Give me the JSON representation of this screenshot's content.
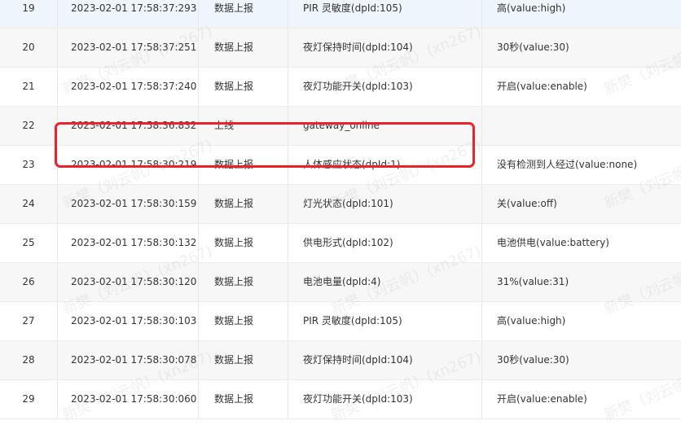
{
  "rows": [
    {
      "idx": "19",
      "time": "2023-02-01 17:58:37:293",
      "type": "数据上报",
      "event": "PIR 灵敏度(dpId:105)",
      "value": "高(value:high)"
    },
    {
      "idx": "20",
      "time": "2023-02-01 17:58:37:251",
      "type": "数据上报",
      "event": "夜灯保持时间(dpId:104)",
      "value": "30秒(value:30)"
    },
    {
      "idx": "21",
      "time": "2023-02-01 17:58:37:240",
      "type": "数据上报",
      "event": "夜灯功能开关(dpId:103)",
      "value": "开启(value:enable)"
    },
    {
      "idx": "22",
      "time": "2023-02-01 17:58:36:832",
      "type": "上线",
      "event": "gateway_online",
      "value": ""
    },
    {
      "idx": "23",
      "time": "2023-02-01 17:58:30:219",
      "type": "数据上报",
      "event": "人体感应状态(dpId:1)",
      "value": "没有检测到人经过(value:none)"
    },
    {
      "idx": "24",
      "time": "2023-02-01 17:58:30:159",
      "type": "数据上报",
      "event": "灯光状态(dpId:101)",
      "value": "关(value:off)"
    },
    {
      "idx": "25",
      "time": "2023-02-01 17:58:30:132",
      "type": "数据上报",
      "event": "供电形式(dpId:102)",
      "value": "电池供电(value:battery)"
    },
    {
      "idx": "26",
      "time": "2023-02-01 17:58:30:120",
      "type": "数据上报",
      "event": "电池电量(dpId:4)",
      "value": "31%(value:31)"
    },
    {
      "idx": "27",
      "time": "2023-02-01 17:58:30:103",
      "type": "数据上报",
      "event": "PIR 灵敏度(dpId:105)",
      "value": "高(value:high)"
    },
    {
      "idx": "28",
      "time": "2023-02-01 17:58:30:078",
      "type": "数据上报",
      "event": "夜灯保持时间(dpId:104)",
      "value": "30秒(value:30)"
    },
    {
      "idx": "29",
      "time": "2023-02-01 17:58:30:060",
      "type": "数据上报",
      "event": "夜灯功能开关(dpId:103)",
      "value": "开启(value:enable)"
    }
  ],
  "watermark": "新樊（刘云帆）(xn267)",
  "colors": {
    "highlight_border": "#e8232c",
    "row_hover": "#eef5fd",
    "row_stripe": "#f7f7f7"
  }
}
